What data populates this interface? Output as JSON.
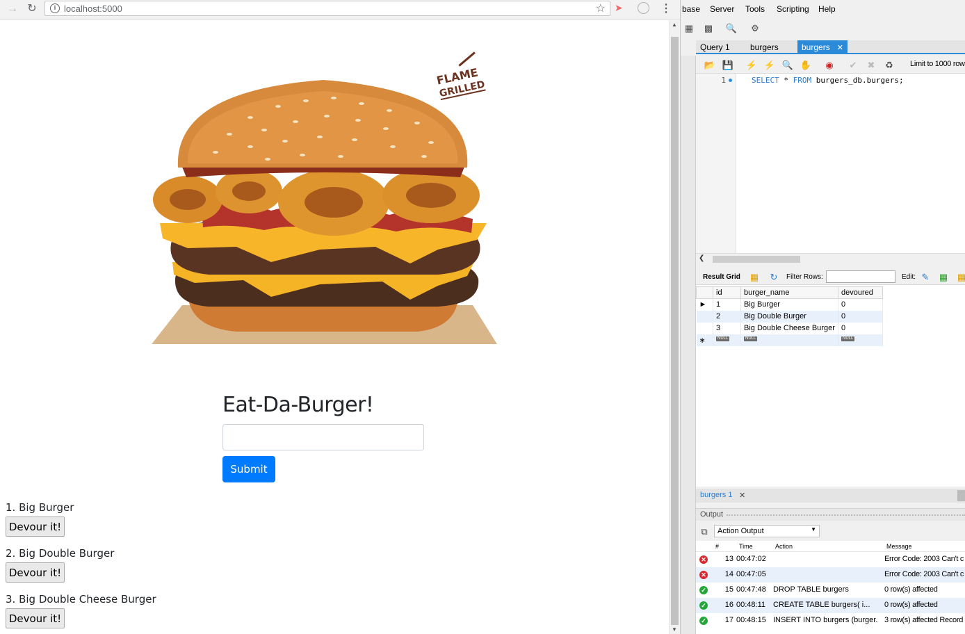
{
  "browser": {
    "url": "localhost:5000",
    "page": {
      "title": "Eat-Da-Burger!",
      "input_value": "",
      "submit_label": "Submit",
      "badge_text": "FLAME GRILLED",
      "burgers": [
        {
          "label": "1. Big Burger",
          "button": "Devour it!"
        },
        {
          "label": "2. Big Double Burger",
          "button": "Devour it!"
        },
        {
          "label": "3. Big Double Cheese Burger",
          "button": "Devour it!"
        }
      ]
    }
  },
  "workbench": {
    "menu": [
      "base",
      "Server",
      "Tools",
      "Scripting",
      "Help"
    ],
    "tabs": {
      "query": "Query 1",
      "burgers": "burgers",
      "burgers_active": "burgers"
    },
    "limit_text": "Limit to 1000 row",
    "editor": {
      "line_number": "1",
      "sql_select": "SELECT",
      "sql_star": " * ",
      "sql_from": "FROM",
      "sql_rest": " burgers_db.burgers;"
    },
    "result_toolbar": {
      "grid_label": "Result Grid",
      "filter_label": "Filter Rows:",
      "edit_label": "Edit:"
    },
    "grid": {
      "columns": [
        "id",
        "burger_name",
        "devoured"
      ],
      "rows": [
        {
          "id": "1",
          "burger_name": "Big Burger",
          "devoured": "0"
        },
        {
          "id": "2",
          "burger_name": "Big Double Burger",
          "devoured": "0"
        },
        {
          "id": "3",
          "burger_name": "Big Double Cheese Burger",
          "devoured": "0"
        }
      ],
      "null_tag": "NULL"
    },
    "result_tab": "burgers 1",
    "output": {
      "title": "Output",
      "selector": "Action Output",
      "columns": [
        "#",
        "Time",
        "Action",
        "Message"
      ],
      "rows": [
        {
          "status": "error",
          "num": "13",
          "time": "00:47:02",
          "action": "",
          "message": "Error Code: 2003 Can't c"
        },
        {
          "status": "error",
          "num": "14",
          "time": "00:47:05",
          "action": "",
          "message": "Error Code: 2003 Can't c"
        },
        {
          "status": "ok",
          "num": "15",
          "time": "00:47:48",
          "action": "DROP TABLE burgers",
          "message": "0 row(s) affected"
        },
        {
          "status": "ok",
          "num": "16",
          "time": "00:48:11",
          "action": "CREATE TABLE burgers(     i...",
          "message": "0 row(s) affected"
        },
        {
          "status": "ok",
          "num": "17",
          "time": "00:48:15",
          "action": "INSERT INTO burgers (burger...",
          "message": "3 row(s) affected Record"
        }
      ]
    }
  }
}
